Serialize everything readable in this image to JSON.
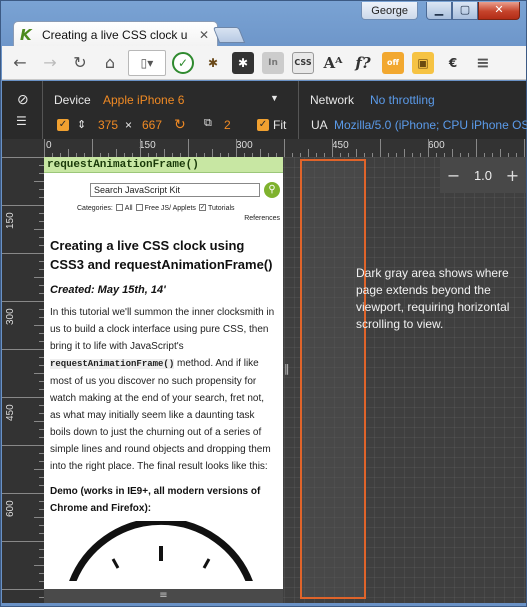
{
  "window": {
    "user": "George"
  },
  "tab": {
    "title": "Creating a live CSS clock u"
  },
  "emulation": {
    "device_label": "Device",
    "device_value": "Apple iPhone 6",
    "width": "375",
    "height": "667",
    "scale": "2",
    "fit_label": "Fit",
    "network_label": "Network",
    "network_value": "No throttling",
    "ua_label": "UA",
    "ua_value": "Mozilla/5.0 (iPhone; CPU iPhone OS"
  },
  "ruler": {
    "h_labels": [
      "0",
      "150",
      "300",
      "450",
      "600"
    ],
    "v_labels": [
      "150",
      "300",
      "450",
      "600"
    ]
  },
  "zoom": {
    "value": "1.0",
    "minus": "−",
    "plus": "+"
  },
  "note": "Dark gray area shows where page extends beyond the viewport, requiring horizontal scrolling to view.",
  "page": {
    "banner": "requestAnimationFrame()",
    "search_placeholder": "Search JavaScript Kit",
    "categories_label": "Categories:",
    "cat_all": "All",
    "cat_free": "Free JS/ Applets",
    "cat_tutorials": "Tutorials",
    "cat_references": "References",
    "heading": "Creating a live CSS clock using CSS3 and requestAnimationFrame()",
    "created": "Created: May 15th, 14'",
    "para1_a": "In this tutorial we'll summon the inner clocksmith in us to build a clock interface using pure CSS, then bring it to life with JavaScript's",
    "para1_code": "requestAnimationFrame()",
    "para1_b": "method. And if like most of us you discover no such propensity for watch making at the end of your search, fret not, as what may initially seem like a daunting task boils down to just the churning out of a series of simple lines and round objects and dropping them into the right place. The final result looks like this:",
    "demo": "Demo (works in IE9+, all modern versions of Chrome and Firefox):"
  }
}
